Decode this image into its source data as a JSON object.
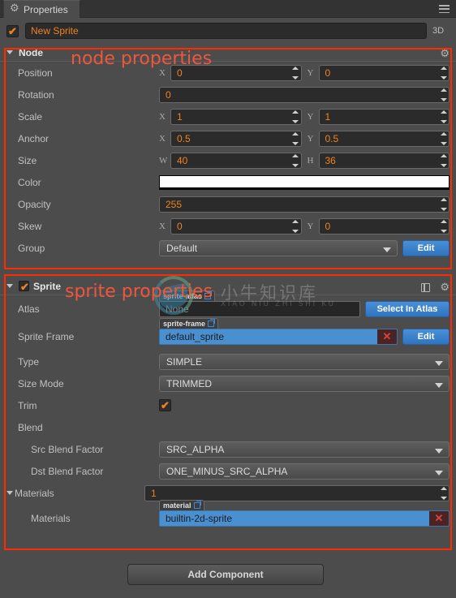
{
  "window": {
    "tab_label": "Properties",
    "tab_icon": "gear-icon",
    "menu_icon": "hamburger-menu-icon"
  },
  "node_name_row": {
    "enabled_checkbox": true,
    "name_value": "New Sprite",
    "mode_badge": "3D"
  },
  "annotations": {
    "node": "node properties",
    "sprite": "sprite properties",
    "color": "#f0563c"
  },
  "watermark": {
    "chinese": "小牛知识库",
    "pinyin": "XIAO NIU ZHI SHI KU"
  },
  "node_section": {
    "title": "Node",
    "expanded": true,
    "gear_icon": "gear-icon",
    "rows": [
      {
        "label": "Position",
        "type": "xy",
        "x_axis": "X",
        "x_value": "0",
        "y_axis": "Y",
        "y_value": "0"
      },
      {
        "label": "Rotation",
        "type": "single",
        "value": "0"
      },
      {
        "label": "Scale",
        "type": "xy",
        "x_axis": "X",
        "x_value": "1",
        "y_axis": "Y",
        "y_value": "1"
      },
      {
        "label": "Anchor",
        "type": "xy",
        "x_axis": "X",
        "x_value": "0.5",
        "y_axis": "Y",
        "y_value": "0.5"
      },
      {
        "label": "Size",
        "type": "xy",
        "x_axis": "W",
        "x_value": "40",
        "y_axis": "H",
        "y_value": "36"
      },
      {
        "label": "Color",
        "type": "color",
        "swatch": "#ffffff"
      },
      {
        "label": "Opacity",
        "type": "single",
        "value": "255"
      },
      {
        "label": "Skew",
        "type": "xy",
        "x_axis": "X",
        "x_value": "0",
        "y_axis": "Y",
        "y_value": "0"
      },
      {
        "label": "Group",
        "type": "dropdown_button",
        "value": "Default",
        "button": "Edit"
      }
    ]
  },
  "sprite_section": {
    "title": "Sprite",
    "expanded": true,
    "enabled_checkbox": true,
    "help_icon": "book-icon",
    "gear_icon": "gear-icon",
    "atlas": {
      "label": "Atlas",
      "tag": "sprite-atlas",
      "tag_icon": "external-link-icon",
      "value": "None",
      "button": "Select In Atlas"
    },
    "sprite_frame": {
      "label": "Sprite Frame",
      "tag": "sprite-frame",
      "tag_icon": "external-link-icon",
      "value": "default_sprite",
      "clear_icon": "clear-x-icon",
      "button": "Edit"
    },
    "type": {
      "label": "Type",
      "value": "SIMPLE"
    },
    "size_mode": {
      "label": "Size Mode",
      "value": "TRIMMED"
    },
    "trim": {
      "label": "Trim",
      "checked": true
    },
    "blend": {
      "label": "Blend"
    },
    "src_blend": {
      "label": "Src Blend Factor",
      "value": "SRC_ALPHA"
    },
    "dst_blend": {
      "label": "Dst Blend Factor",
      "value": "ONE_MINUS_SRC_ALPHA"
    },
    "materials_count": {
      "label": "Materials",
      "value": "1"
    },
    "materials_item": {
      "label": "Materials",
      "tag": "material",
      "tag_icon": "external-link-icon",
      "value": "builtin-2d-sprite",
      "clear_icon": "clear-x-icon"
    }
  },
  "footer": {
    "add_component": "Add Component"
  }
}
